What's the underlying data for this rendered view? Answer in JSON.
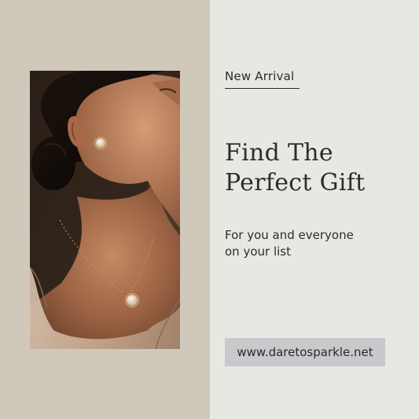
{
  "tag": {
    "label": "New Arrival"
  },
  "headline": {
    "line1": "Find The",
    "line2": "Perfect Gift"
  },
  "subtext": {
    "line1": "For you and everyone",
    "line2": "on your list"
  },
  "website": {
    "url": "www.daretosparkle.net"
  },
  "photo": {
    "alt": "Model wearing gold earring and pearl pendant necklace"
  },
  "colors": {
    "left_panel": "#d1c8bc",
    "right_panel": "#e8e8e3",
    "url_box": "#c9c8cc",
    "text": "#2b2b2b"
  }
}
